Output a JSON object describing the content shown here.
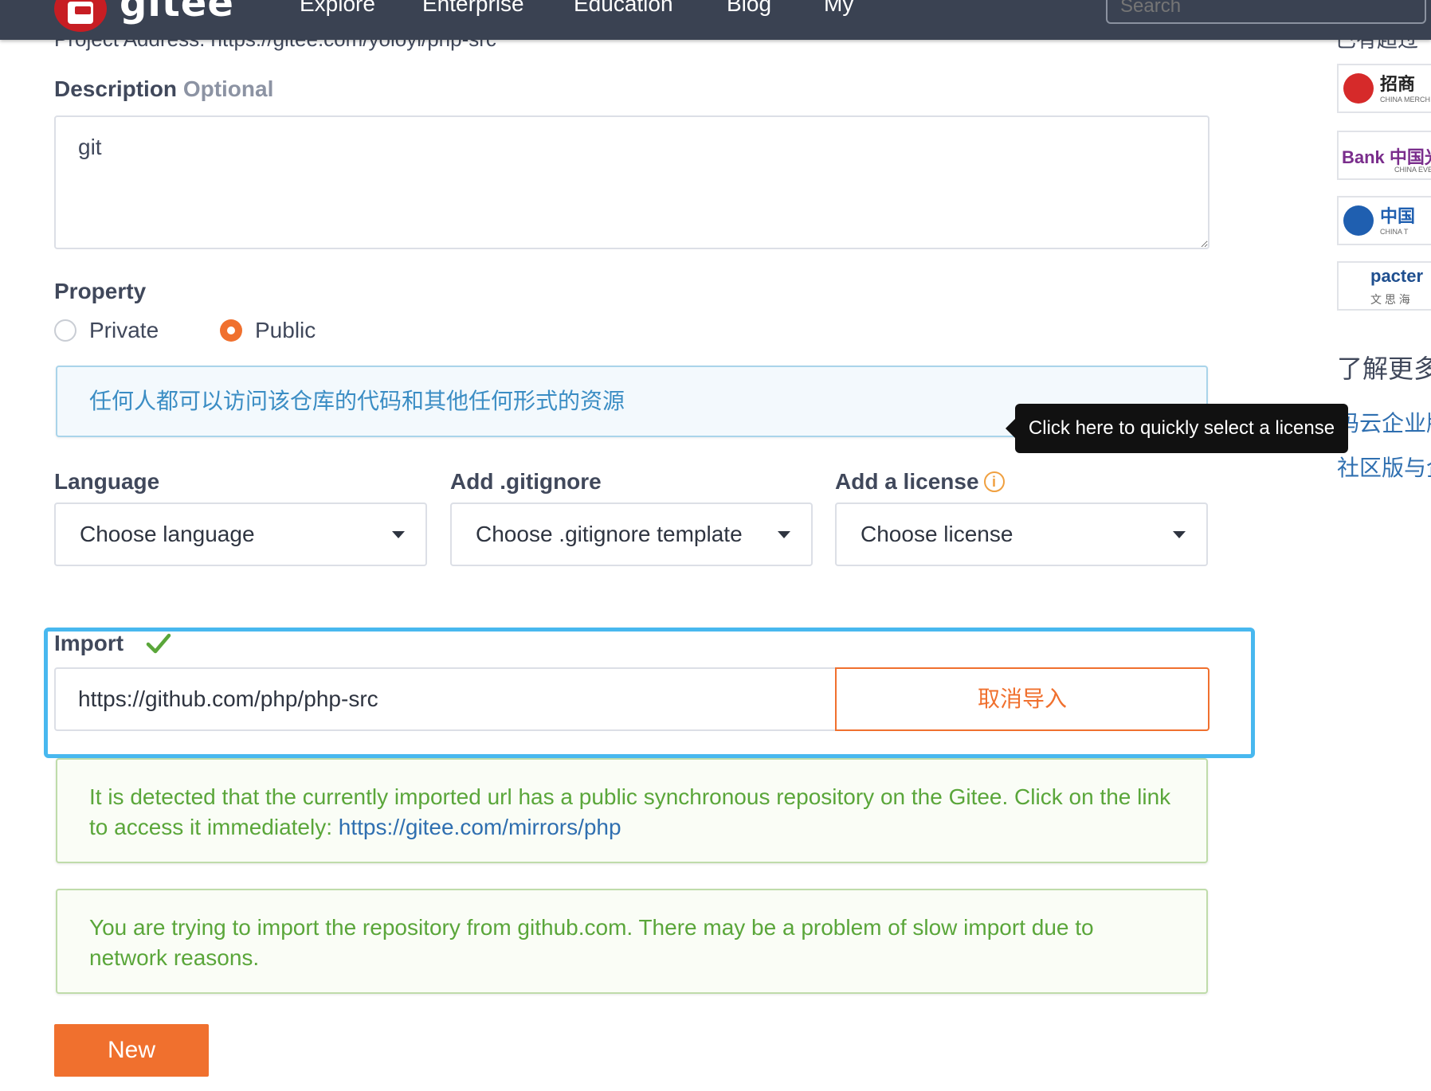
{
  "nav": {
    "logo_text": "gitee",
    "items": [
      "Explore",
      "Enterprise",
      "Education",
      "Blog",
      "My"
    ],
    "search_placeholder": "Search"
  },
  "project_address": "Project Address: https://gitee.com/yoloyi/php-src",
  "description": {
    "label": "Description",
    "optional": "Optional",
    "value": "git"
  },
  "property": {
    "label": "Property",
    "options": [
      "Private",
      "Public"
    ],
    "selected": "Public",
    "info": "任何人都可以访问该仓库的代码和其他任何形式的资源"
  },
  "tooltip": "Click here to quickly select a license",
  "language": {
    "label": "Language",
    "value": "Choose language"
  },
  "gitignore": {
    "label": "Add .gitignore",
    "value": "Choose .gitignore template"
  },
  "license": {
    "label": "Add a license",
    "value": "Choose license"
  },
  "import": {
    "label": "Import",
    "url": "https://github.com/php/php-src",
    "cancel_label": "取消导入"
  },
  "notices": {
    "mirror_text": "It is detected that the currently imported url has a public synchronous repository on the Gitee. Click on the link to access it immediately:",
    "mirror_link": "https://gitee.com/mirrors/php",
    "github_text": "You are trying to import the repository from github.com. There may be a problem of slow import due to network reasons."
  },
  "submit_label": "New",
  "sidebar": {
    "top_text": "已有超过",
    "sponsors": [
      {
        "text": "招商",
        "sub": "CHINA MERCH"
      },
      {
        "text": "Bank 中国光",
        "sub": "CHINA EVE"
      },
      {
        "text": "中国",
        "sub": "CHINA T"
      },
      {
        "text": "pacter",
        "sub": "文 思 海"
      }
    ],
    "heading": "了解更多",
    "links": [
      "码云企业版",
      "社区版与企"
    ]
  },
  "colors": {
    "nav_bg": "#3a4252",
    "accent": "#f0702e",
    "import_highlight": "#48b8ef",
    "success": "#5aa63a",
    "link": "#2f6fb0"
  }
}
